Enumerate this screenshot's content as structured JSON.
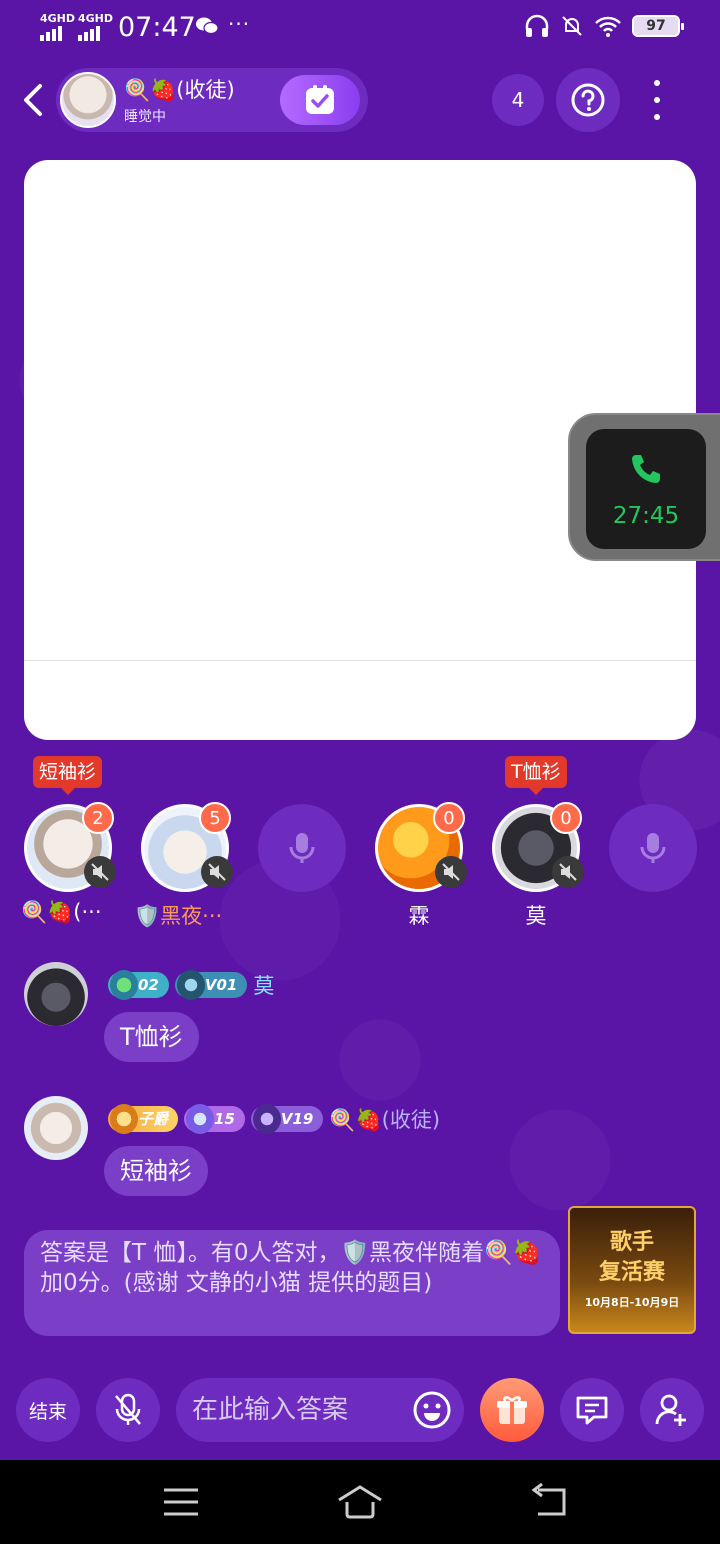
{
  "status_bar": {
    "network1": "4GHD",
    "network2": "4GHD",
    "time": "07:47",
    "more": "···",
    "battery": "97"
  },
  "header": {
    "host_name": "🍭🍓(收徒)",
    "host_status": "睡觉中",
    "online_count": "4"
  },
  "call": {
    "duration": "27:45"
  },
  "seats": [
    {
      "name": "🍭🍓(···",
      "count": "2",
      "tag": "短袖衫"
    },
    {
      "name": "🛡️黑夜···",
      "count": "5"
    },
    {
      "name": "",
      "empty": true
    },
    {
      "name": "霖",
      "count": "0"
    },
    {
      "name": "莫",
      "count": "0",
      "tag": "T恤衫"
    },
    {
      "name": "",
      "empty": true
    }
  ],
  "messages": [
    {
      "badges": [
        "02",
        "V01"
      ],
      "name": "莫",
      "text": "T恤衫"
    },
    {
      "badges": [
        "子爵",
        "15",
        "V19"
      ],
      "name": "🍭🍓(收徒)",
      "text": "短袖衫"
    }
  ],
  "system_message": "答案是【T 恤】。有0人答对，🛡️黑夜伴随着🍭🍓加0分。(感谢 文静的小猫 提供的题目)",
  "promo": {
    "title_line1": "歌手",
    "title_line2": "复活赛",
    "date": "10月8日-10月9日"
  },
  "bottom_bar": {
    "end_label": "结束",
    "input_placeholder": "在此输入答案"
  },
  "colors": {
    "background": "#5a14a6",
    "pill": "#6e2bc0",
    "bubble": "#7a3ec7",
    "badge": "#ff6b4a",
    "tag": "#e2392a",
    "call_green": "#22c55e"
  }
}
